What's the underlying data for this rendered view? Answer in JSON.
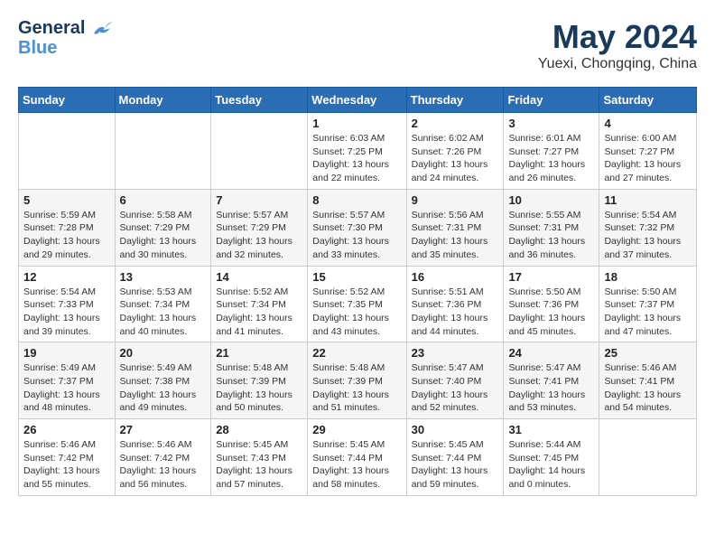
{
  "header": {
    "logo_general": "General",
    "logo_blue": "Blue",
    "month": "May 2024",
    "location": "Yuexi, Chongqing, China"
  },
  "weekdays": [
    "Sunday",
    "Monday",
    "Tuesday",
    "Wednesday",
    "Thursday",
    "Friday",
    "Saturday"
  ],
  "weeks": [
    [
      {
        "day": "",
        "sunrise": "",
        "sunset": "",
        "daylight": ""
      },
      {
        "day": "",
        "sunrise": "",
        "sunset": "",
        "daylight": ""
      },
      {
        "day": "",
        "sunrise": "",
        "sunset": "",
        "daylight": ""
      },
      {
        "day": "1",
        "sunrise": "Sunrise: 6:03 AM",
        "sunset": "Sunset: 7:25 PM",
        "daylight": "Daylight: 13 hours and 22 minutes."
      },
      {
        "day": "2",
        "sunrise": "Sunrise: 6:02 AM",
        "sunset": "Sunset: 7:26 PM",
        "daylight": "Daylight: 13 hours and 24 minutes."
      },
      {
        "day": "3",
        "sunrise": "Sunrise: 6:01 AM",
        "sunset": "Sunset: 7:27 PM",
        "daylight": "Daylight: 13 hours and 26 minutes."
      },
      {
        "day": "4",
        "sunrise": "Sunrise: 6:00 AM",
        "sunset": "Sunset: 7:27 PM",
        "daylight": "Daylight: 13 hours and 27 minutes."
      }
    ],
    [
      {
        "day": "5",
        "sunrise": "Sunrise: 5:59 AM",
        "sunset": "Sunset: 7:28 PM",
        "daylight": "Daylight: 13 hours and 29 minutes."
      },
      {
        "day": "6",
        "sunrise": "Sunrise: 5:58 AM",
        "sunset": "Sunset: 7:29 PM",
        "daylight": "Daylight: 13 hours and 30 minutes."
      },
      {
        "day": "7",
        "sunrise": "Sunrise: 5:57 AM",
        "sunset": "Sunset: 7:29 PM",
        "daylight": "Daylight: 13 hours and 32 minutes."
      },
      {
        "day": "8",
        "sunrise": "Sunrise: 5:57 AM",
        "sunset": "Sunset: 7:30 PM",
        "daylight": "Daylight: 13 hours and 33 minutes."
      },
      {
        "day": "9",
        "sunrise": "Sunrise: 5:56 AM",
        "sunset": "Sunset: 7:31 PM",
        "daylight": "Daylight: 13 hours and 35 minutes."
      },
      {
        "day": "10",
        "sunrise": "Sunrise: 5:55 AM",
        "sunset": "Sunset: 7:31 PM",
        "daylight": "Daylight: 13 hours and 36 minutes."
      },
      {
        "day": "11",
        "sunrise": "Sunrise: 5:54 AM",
        "sunset": "Sunset: 7:32 PM",
        "daylight": "Daylight: 13 hours and 37 minutes."
      }
    ],
    [
      {
        "day": "12",
        "sunrise": "Sunrise: 5:54 AM",
        "sunset": "Sunset: 7:33 PM",
        "daylight": "Daylight: 13 hours and 39 minutes."
      },
      {
        "day": "13",
        "sunrise": "Sunrise: 5:53 AM",
        "sunset": "Sunset: 7:34 PM",
        "daylight": "Daylight: 13 hours and 40 minutes."
      },
      {
        "day": "14",
        "sunrise": "Sunrise: 5:52 AM",
        "sunset": "Sunset: 7:34 PM",
        "daylight": "Daylight: 13 hours and 41 minutes."
      },
      {
        "day": "15",
        "sunrise": "Sunrise: 5:52 AM",
        "sunset": "Sunset: 7:35 PM",
        "daylight": "Daylight: 13 hours and 43 minutes."
      },
      {
        "day": "16",
        "sunrise": "Sunrise: 5:51 AM",
        "sunset": "Sunset: 7:36 PM",
        "daylight": "Daylight: 13 hours and 44 minutes."
      },
      {
        "day": "17",
        "sunrise": "Sunrise: 5:50 AM",
        "sunset": "Sunset: 7:36 PM",
        "daylight": "Daylight: 13 hours and 45 minutes."
      },
      {
        "day": "18",
        "sunrise": "Sunrise: 5:50 AM",
        "sunset": "Sunset: 7:37 PM",
        "daylight": "Daylight: 13 hours and 47 minutes."
      }
    ],
    [
      {
        "day": "19",
        "sunrise": "Sunrise: 5:49 AM",
        "sunset": "Sunset: 7:37 PM",
        "daylight": "Daylight: 13 hours and 48 minutes."
      },
      {
        "day": "20",
        "sunrise": "Sunrise: 5:49 AM",
        "sunset": "Sunset: 7:38 PM",
        "daylight": "Daylight: 13 hours and 49 minutes."
      },
      {
        "day": "21",
        "sunrise": "Sunrise: 5:48 AM",
        "sunset": "Sunset: 7:39 PM",
        "daylight": "Daylight: 13 hours and 50 minutes."
      },
      {
        "day": "22",
        "sunrise": "Sunrise: 5:48 AM",
        "sunset": "Sunset: 7:39 PM",
        "daylight": "Daylight: 13 hours and 51 minutes."
      },
      {
        "day": "23",
        "sunrise": "Sunrise: 5:47 AM",
        "sunset": "Sunset: 7:40 PM",
        "daylight": "Daylight: 13 hours and 52 minutes."
      },
      {
        "day": "24",
        "sunrise": "Sunrise: 5:47 AM",
        "sunset": "Sunset: 7:41 PM",
        "daylight": "Daylight: 13 hours and 53 minutes."
      },
      {
        "day": "25",
        "sunrise": "Sunrise: 5:46 AM",
        "sunset": "Sunset: 7:41 PM",
        "daylight": "Daylight: 13 hours and 54 minutes."
      }
    ],
    [
      {
        "day": "26",
        "sunrise": "Sunrise: 5:46 AM",
        "sunset": "Sunset: 7:42 PM",
        "daylight": "Daylight: 13 hours and 55 minutes."
      },
      {
        "day": "27",
        "sunrise": "Sunrise: 5:46 AM",
        "sunset": "Sunset: 7:42 PM",
        "daylight": "Daylight: 13 hours and 56 minutes."
      },
      {
        "day": "28",
        "sunrise": "Sunrise: 5:45 AM",
        "sunset": "Sunset: 7:43 PM",
        "daylight": "Daylight: 13 hours and 57 minutes."
      },
      {
        "day": "29",
        "sunrise": "Sunrise: 5:45 AM",
        "sunset": "Sunset: 7:44 PM",
        "daylight": "Daylight: 13 hours and 58 minutes."
      },
      {
        "day": "30",
        "sunrise": "Sunrise: 5:45 AM",
        "sunset": "Sunset: 7:44 PM",
        "daylight": "Daylight: 13 hours and 59 minutes."
      },
      {
        "day": "31",
        "sunrise": "Sunrise: 5:44 AM",
        "sunset": "Sunset: 7:45 PM",
        "daylight": "Daylight: 14 hours and 0 minutes."
      },
      {
        "day": "",
        "sunrise": "",
        "sunset": "",
        "daylight": ""
      }
    ]
  ]
}
